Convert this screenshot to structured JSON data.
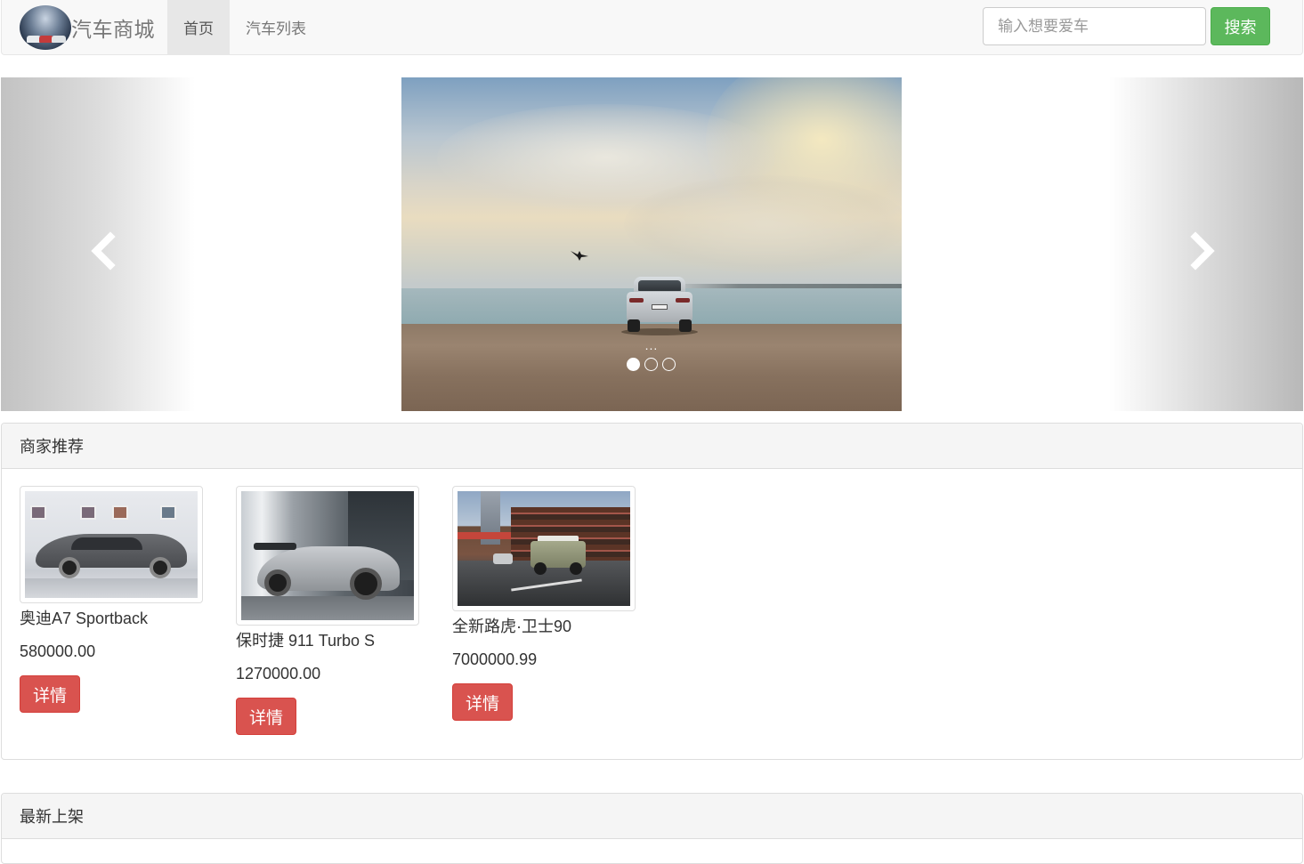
{
  "navbar": {
    "brand": "汽车商城",
    "nav_items": [
      "首页",
      "汽车列表"
    ],
    "active_index": 0,
    "search": {
      "placeholder": "输入想要爱车",
      "value": ""
    },
    "search_button": "搜索"
  },
  "carousel": {
    "caption": "...",
    "slide_count": 3,
    "active_slide": 1
  },
  "recommend": {
    "title": "商家推荐",
    "items": [
      {
        "name": "奥迪A7 Sportback",
        "price": "580000.00",
        "button": "详情"
      },
      {
        "name": "保时捷 911 Turbo S",
        "price": "1270000.00",
        "button": "详情"
      },
      {
        "name": "全新路虎·卫士90",
        "price": "7000000.99",
        "button": "详情"
      }
    ]
  },
  "latest": {
    "title": "最新上架"
  },
  "colors": {
    "search_button": "#5cb85c",
    "detail_button": "#d9534f",
    "navbar_bg": "#f8f8f8"
  }
}
